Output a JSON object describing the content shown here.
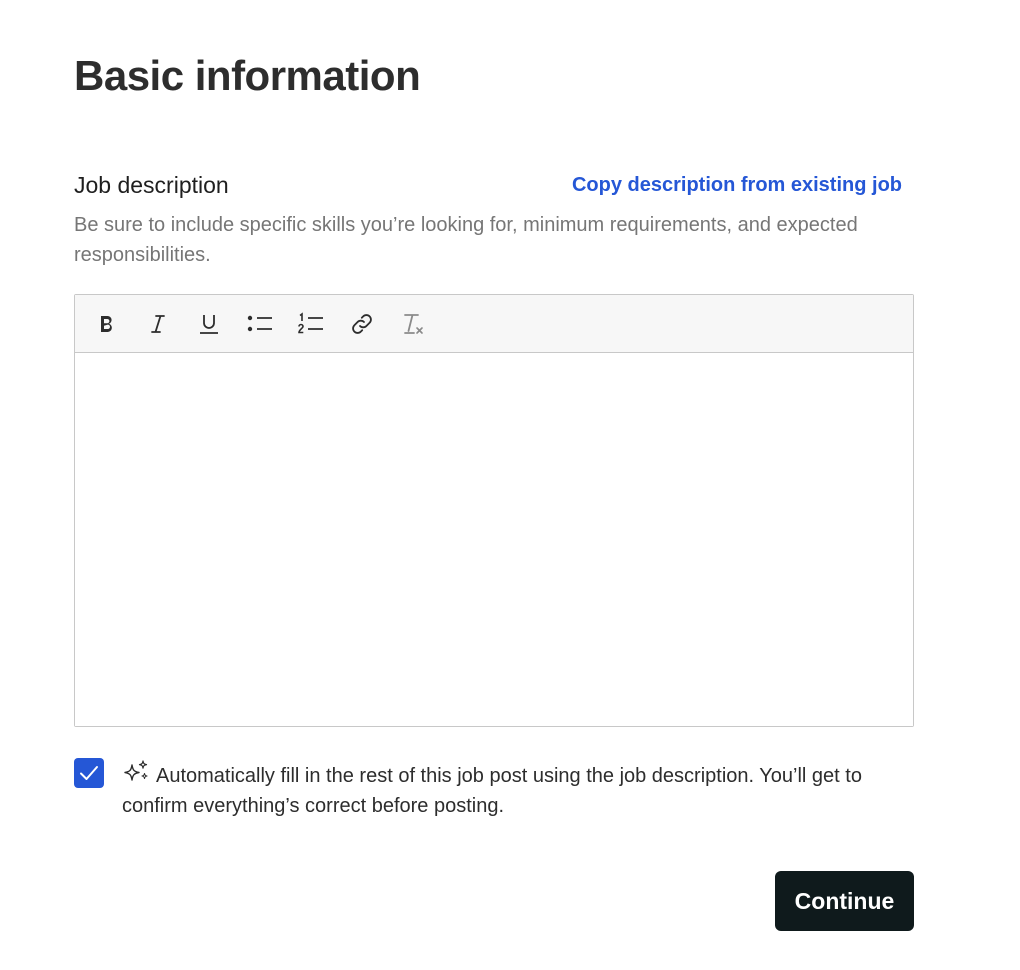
{
  "page": {
    "title": "Basic information"
  },
  "job_description": {
    "label": "Job description",
    "copy_link": "Copy description from existing job",
    "help_text": "Be sure to include specific skills you’re looking for, minimum requirements, and expected responsibilities.",
    "value": "",
    "toolbar": [
      {
        "name": "bold-icon",
        "label": "Bold"
      },
      {
        "name": "italic-icon",
        "label": "Italic"
      },
      {
        "name": "underline-icon",
        "label": "Underline"
      },
      {
        "name": "bulleted-list-icon",
        "label": "Bulleted list"
      },
      {
        "name": "numbered-list-icon",
        "label": "Numbered list"
      },
      {
        "name": "link-icon",
        "label": "Link"
      },
      {
        "name": "clear-formatting-icon",
        "label": "Clear formatting"
      }
    ]
  },
  "autofill": {
    "checked": true,
    "icon": "sparkle-icon",
    "text": "Automatically fill in the rest of this job post using the job description. You’ll get to confirm everything’s correct before posting."
  },
  "actions": {
    "continue_label": "Continue"
  },
  "colors": {
    "accent": "#2557d6",
    "primary_button": "#0f1a1c",
    "help_text": "#767676",
    "border": "#c8c8c8",
    "toolbar_bg": "#f7f7f7"
  }
}
